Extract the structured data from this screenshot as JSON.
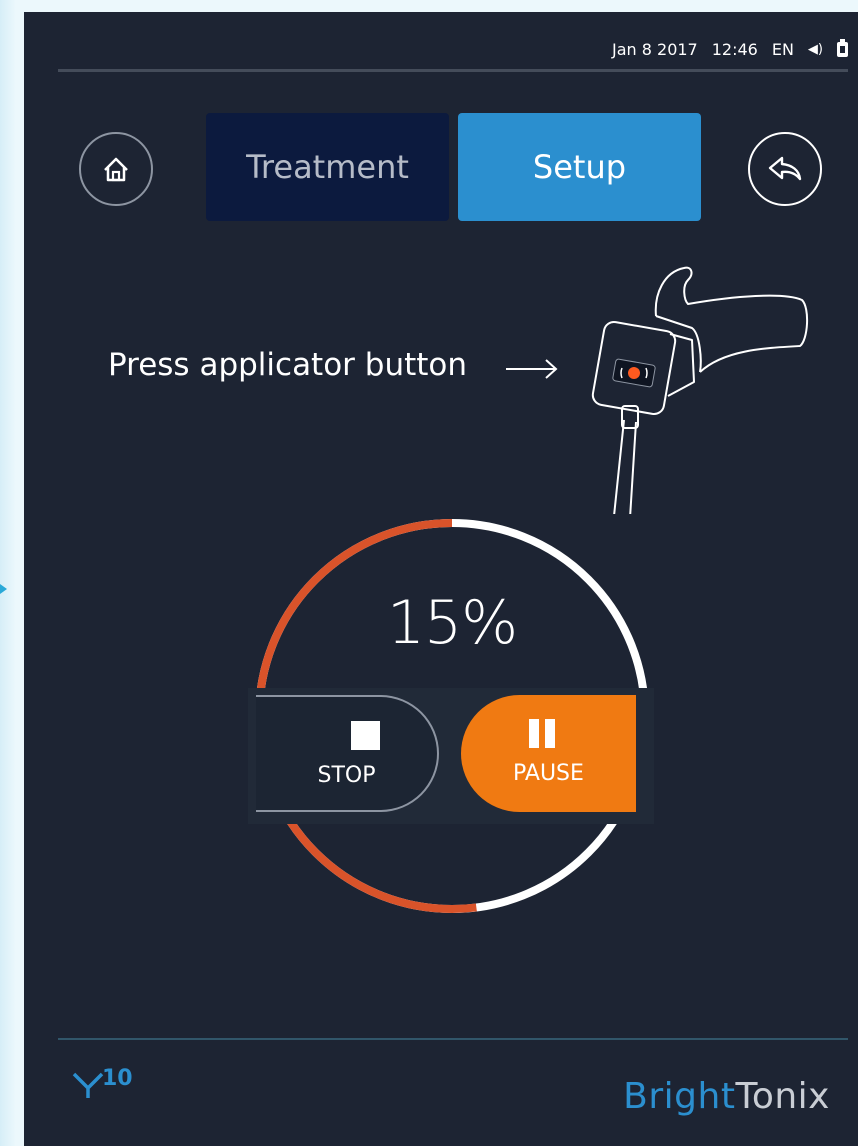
{
  "status_bar": {
    "date": "Jan 8 2017",
    "time": "12:46",
    "language": "EN"
  },
  "nav": {
    "home_icon": "home-icon",
    "back_icon": "back-arrow-icon"
  },
  "tabs": [
    {
      "label": "Treatment",
      "active": false
    },
    {
      "label": "Setup",
      "active": true
    }
  ],
  "instruction": {
    "text": "Press applicator button"
  },
  "progress": {
    "percent_label": "15%",
    "value": 0.15
  },
  "controls": {
    "stop_label": "STOP",
    "pause_label": "PAUSE"
  },
  "footer": {
    "logo_mark": "Y",
    "logo_superscript": "10",
    "brand_part1": "Bright",
    "brand_part2": "Tonix"
  },
  "colors": {
    "background": "#1d2433",
    "accent_blue": "#2b8fcf",
    "accent_orange": "#f07a12",
    "progress_ring": "#d9532a"
  }
}
